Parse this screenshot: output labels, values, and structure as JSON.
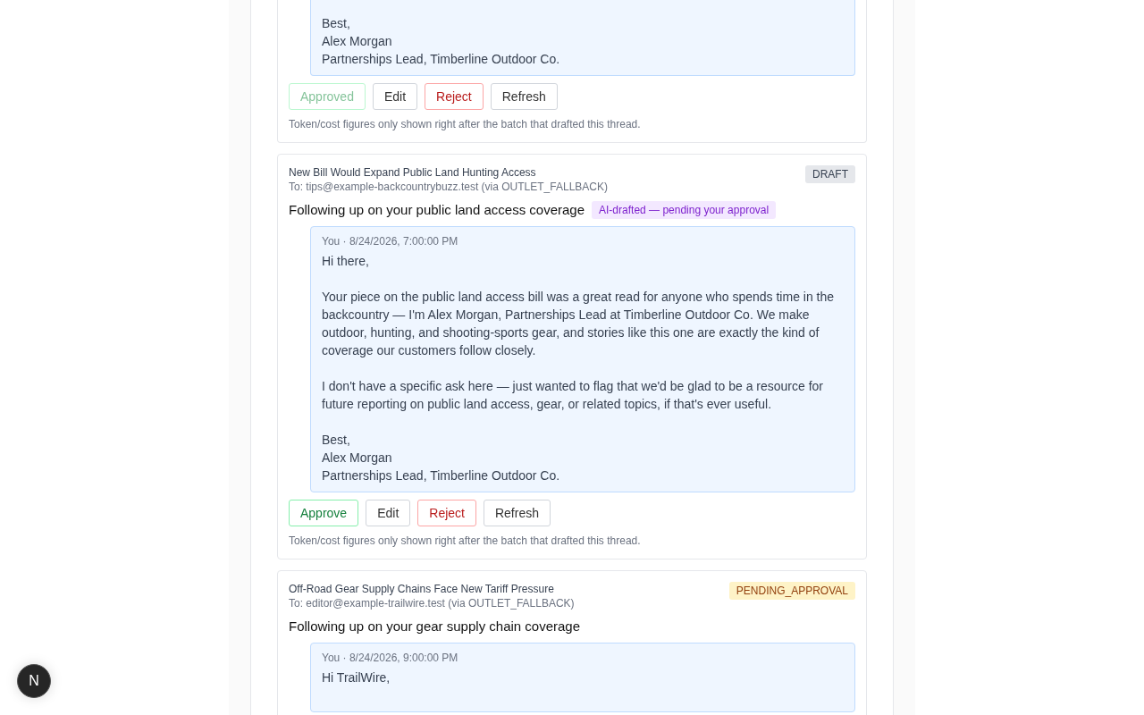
{
  "threads": [
    {
      "cut": true,
      "messages": [
        {
          "body": "Best,\nAlex Morgan\nPartnerships Lead, Timberline Outdoor Co."
        }
      ],
      "actions": [
        {
          "label": "Approved",
          "kind": "approve",
          "disabled": true
        },
        {
          "label": "Edit",
          "kind": "plain",
          "disabled": false
        },
        {
          "label": "Reject",
          "kind": "reject",
          "disabled": false
        },
        {
          "label": "Refresh",
          "kind": "plain",
          "disabled": false
        }
      ],
      "note": "Token/cost figures only shown right after the batch that drafted this thread."
    },
    {
      "cut": false,
      "title": "New Bill Would Expand Public Land Hunting Access",
      "to": "To: tips@example-backcountrybuzz.test (via OUTLET_FALLBACK)",
      "status": {
        "label": "DRAFT",
        "kind": "draft"
      },
      "subject": "Following up on your public land access coverage",
      "ai_badge": "AI-drafted — pending your approval",
      "messages": [
        {
          "meta": "You · 8/24/2026, 7:00:00 PM",
          "body": "Hi there,\n\nYour piece on the public land access bill was a great read for anyone who spends time in the backcountry — I'm Alex Morgan, Partnerships Lead at Timberline Outdoor Co. We make outdoor, hunting, and shooting-sports gear, and stories like this one are exactly the kind of coverage our customers follow closely.\n\nI don't have a specific ask here — just wanted to flag that we'd be glad to be a resource for future reporting on public land access, gear, or related topics, if that's ever useful.\n\nBest,\nAlex Morgan\nPartnerships Lead, Timberline Outdoor Co."
        }
      ],
      "actions": [
        {
          "label": "Approve",
          "kind": "approve",
          "disabled": false
        },
        {
          "label": "Edit",
          "kind": "plain",
          "disabled": false
        },
        {
          "label": "Reject",
          "kind": "reject",
          "disabled": false
        },
        {
          "label": "Refresh",
          "kind": "plain",
          "disabled": false
        }
      ],
      "note": "Token/cost figures only shown right after the batch that drafted this thread."
    },
    {
      "cut": false,
      "title": "Off-Road Gear Supply Chains Face New Tariff Pressure",
      "to": "To: editor@example-trailwire.test (via OUTLET_FALLBACK)",
      "status": {
        "label": "PENDING_APPROVAL",
        "kind": "pending"
      },
      "subject": "Following up on your gear supply chain coverage",
      "messages": [
        {
          "meta": "You · 8/24/2026, 9:00:00 PM",
          "body": "Hi TrailWire,\n\n"
        }
      ]
    }
  ],
  "dev_badge": "N"
}
